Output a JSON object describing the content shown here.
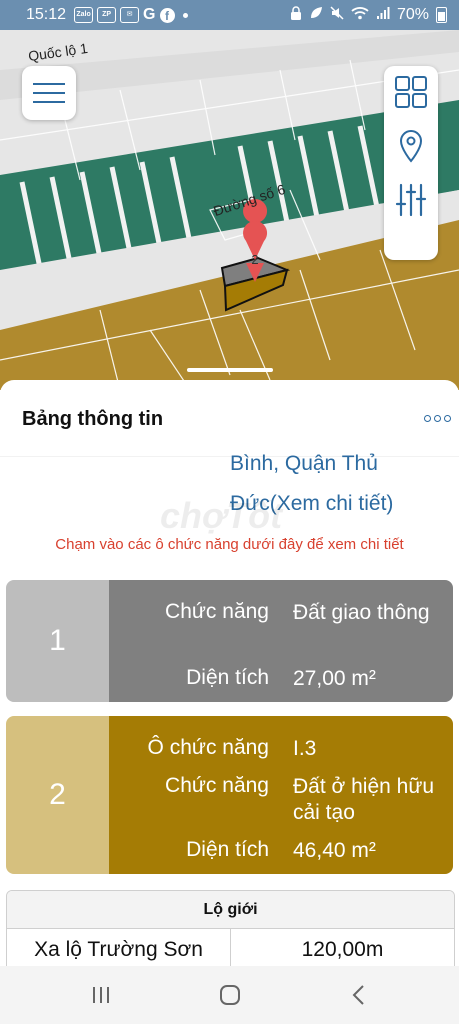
{
  "status_bar": {
    "time": "15:12",
    "app_icons": [
      "Zalo",
      "ZP",
      "mail-icon",
      "G",
      "facebook-icon"
    ],
    "battery": "70%"
  },
  "map": {
    "labels": {
      "road_top": "Quốc lộ 1",
      "road_mid": "Đường số 6"
    },
    "markers": [
      "1",
      "2"
    ],
    "colors": {
      "background": "#e6e6e6",
      "green_zone": "#2e7a64",
      "gold_zone": "#b08a2e"
    }
  },
  "sheet": {
    "title": "Bảng thông tin",
    "address_lines": [
      "Bình, Quận Thủ",
      "Đức(Xem chi tiết)"
    ],
    "watermark": "chợTốt",
    "hint": "Chạm vào các ô chức năng dưới đây để xem chi tiết"
  },
  "cards": [
    {
      "number": "1",
      "rows": [
        {
          "label": "Chức năng",
          "value": "Đất giao thông"
        },
        {
          "label": "Diện tích",
          "value": "27,00 m²"
        }
      ],
      "color_num": "#bdbdbd",
      "color_body": "#808080"
    },
    {
      "number": "2",
      "rows": [
        {
          "label": "Ô chức năng",
          "value": "I.3"
        },
        {
          "label": "Chức năng",
          "value": "Đất ở hiện hữu cải tạo"
        },
        {
          "label": "Diện tích",
          "value": "46,40 m²"
        }
      ],
      "color_num": "#d6c07e",
      "color_body": "#a57c05"
    }
  ],
  "roads": {
    "header": "Lộ giới",
    "rows": [
      {
        "name": "Xa lộ Trường Sơn",
        "width": "120,00m"
      }
    ]
  }
}
